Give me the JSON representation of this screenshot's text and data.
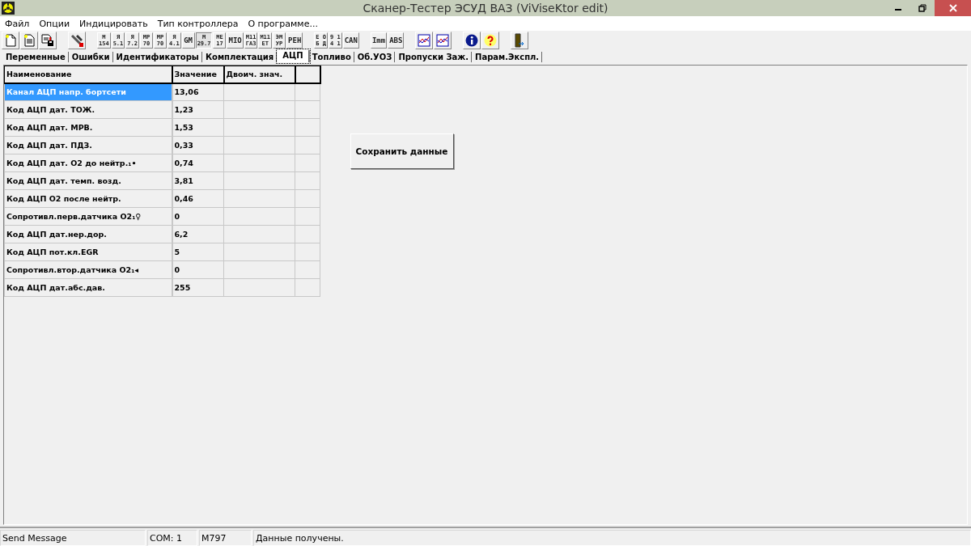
{
  "window": {
    "title": "Сканер-Тестер ЭСУД ВАЗ (ViViseKtor edit)"
  },
  "menu": [
    "Файл",
    "Опции",
    "Индицировать",
    "Тип контроллера",
    "О программе..."
  ],
  "toolbar": [
    {
      "kind": "new-doc"
    },
    {
      "kind": "doc-copy"
    },
    {
      "kind": "doc-save"
    },
    {
      "kind": "gap"
    },
    {
      "kind": "tools"
    },
    {
      "kind": "gap"
    },
    {
      "kind": "text",
      "lines": [
        "М",
        "154"
      ],
      "pressed": false
    },
    {
      "kind": "text",
      "lines": [
        "Я",
        "5.1"
      ],
      "pressed": false
    },
    {
      "kind": "text",
      "lines": [
        "Я",
        "7.2"
      ],
      "pressed": false
    },
    {
      "kind": "text",
      "lines": [
        "MP",
        "70"
      ],
      "pressed": false
    },
    {
      "kind": "text",
      "lines": [
        "MP",
        "70"
      ],
      "pressed": false
    },
    {
      "kind": "text",
      "lines": [
        "Я",
        "4.1"
      ],
      "pressed": false
    },
    {
      "kind": "text",
      "lines": [
        "GM"
      ],
      "pressed": false
    },
    {
      "kind": "text",
      "lines": [
        "М",
        "29.7"
      ],
      "pressed": true
    },
    {
      "kind": "text",
      "lines": [
        "ME",
        "17"
      ],
      "pressed": false
    },
    {
      "kind": "text",
      "lines": [
        "MIO"
      ],
      "pressed": false
    },
    {
      "kind": "text",
      "lines": [
        "M11",
        "ГАЗ"
      ],
      "pressed": false
    },
    {
      "kind": "text",
      "lines": [
        "M11",
        "ET"
      ],
      "pressed": false
    },
    {
      "kind": "text",
      "lines": [
        "ЭМ",
        "УР"
      ],
      "pressed": false
    },
    {
      "kind": "text",
      "lines": [
        "PEH"
      ],
      "pressed": false
    },
    {
      "kind": "gap"
    },
    {
      "kind": "text",
      "lines": [
        "Е О",
        "Б Д"
      ],
      "pressed": false
    },
    {
      "kind": "text",
      "lines": [
        "9 1",
        "4 1"
      ],
      "pressed": false
    },
    {
      "kind": "text",
      "lines": [
        "CAN"
      ],
      "pressed": false
    },
    {
      "kind": "gap"
    },
    {
      "kind": "text",
      "lines": [
        "Imm"
      ],
      "pressed": false
    },
    {
      "kind": "text",
      "lines": [
        "ABS"
      ],
      "pressed": false
    },
    {
      "kind": "gap"
    },
    {
      "kind": "chart"
    },
    {
      "kind": "chart"
    },
    {
      "kind": "gap"
    },
    {
      "kind": "info"
    },
    {
      "kind": "help"
    },
    {
      "kind": "gap"
    },
    {
      "kind": "exit"
    }
  ],
  "tabs": [
    {
      "label": "Переменные",
      "selected": false
    },
    {
      "label": "Ошибки",
      "selected": false
    },
    {
      "label": "Идентификаторы",
      "selected": false
    },
    {
      "label": "Комплектация",
      "selected": false
    },
    {
      "label": "АЦП",
      "selected": true
    },
    {
      "label": "Топливо",
      "selected": false
    },
    {
      "label": "Об.УОЗ",
      "selected": false
    },
    {
      "label": "Пропуски Заж.",
      "selected": false
    },
    {
      "label": "Парам.Экспл.",
      "selected": false
    }
  ],
  "table": {
    "columns": [
      "Наименование",
      "Значение",
      "Двоич. знач."
    ],
    "rows": [
      {
        "name": "Канал АЦП напр. бортсети",
        "value": "13,06",
        "selected": true
      },
      {
        "name": "Код АЦП дат. ТОЖ.",
        "value": "1,23",
        "selected": false
      },
      {
        "name": "Код АЦП дат. МРВ.",
        "value": "1,53",
        "selected": false
      },
      {
        "name": "Код АЦП дат. ПДЗ.",
        "value": "0,33",
        "selected": false
      },
      {
        "name": "Код АЦП дат. О2 до нейтр.₁•",
        "value": "0,74",
        "selected": false
      },
      {
        "name": "Код АЦП дат. темп. возд.",
        "value": "3,81",
        "selected": false
      },
      {
        "name": "Код АЦП О2 после нейтр.",
        "value": "0,46",
        "selected": false
      },
      {
        "name": "Сопротивл.перв.датчика О2₁♀",
        "value": "0",
        "selected": false
      },
      {
        "name": "Код АЦП дат.нер.дор.",
        "value": "6,2",
        "selected": false
      },
      {
        "name": "Код АЦП пот.кл.EGR",
        "value": "5",
        "selected": false
      },
      {
        "name": "Сопротивл.втор.датчика О2₁◂",
        "value": "0",
        "selected": false
      },
      {
        "name": "Код АЦП дат.абс.дав.",
        "value": "255",
        "selected": false
      }
    ]
  },
  "save_button": "Сохранить данные",
  "status_bar": [
    "Send Message",
    "COM: 1",
    "M797",
    "Данные получены."
  ]
}
